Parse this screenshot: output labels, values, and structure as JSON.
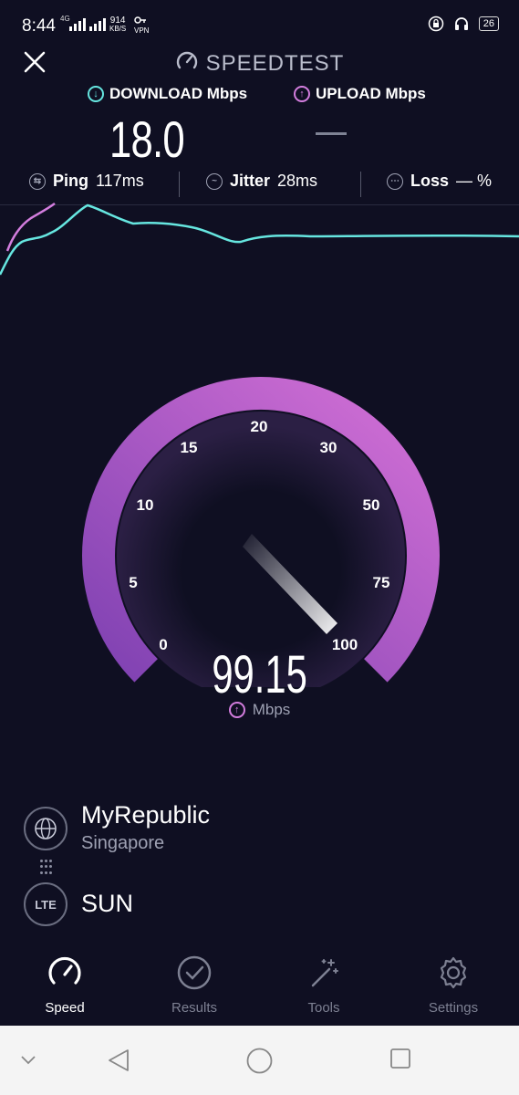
{
  "status_bar": {
    "time": "8:44",
    "network": "4G",
    "speed_value": "914",
    "speed_unit": "KB/S",
    "vpn": "VPN",
    "battery": "26"
  },
  "header": {
    "title": "SPEEDTEST",
    "close_icon": "close-icon"
  },
  "download": {
    "label": "DOWNLOAD Mbps",
    "value": "18.0",
    "color": "#66e6e0"
  },
  "upload": {
    "label": "UPLOAD Mbps",
    "value": "",
    "color": "#d37dde"
  },
  "stats": {
    "ping_label": "Ping",
    "ping_value": "117ms",
    "jitter_label": "Jitter",
    "jitter_value": "28ms",
    "loss_label": "Loss",
    "loss_value": "— %"
  },
  "gauge": {
    "ticks": [
      "0",
      "5",
      "10",
      "15",
      "20",
      "30",
      "50",
      "75",
      "100"
    ],
    "current_speed": "99.15",
    "unit": "Mbps",
    "needle_level": 0.99,
    "arc_color_start": "#7b3fb0",
    "arc_color_end": "#d873d8"
  },
  "provider": {
    "isp_name": "MyRepublic",
    "isp_location": "Singapore",
    "network_type": "LTE",
    "carrier": "SUN"
  },
  "bottom_nav": {
    "items": [
      {
        "label": "Speed",
        "icon": "gauge-icon",
        "active": true
      },
      {
        "label": "Results",
        "icon": "check-circle-icon",
        "active": false
      },
      {
        "label": "Tools",
        "icon": "magic-wand-icon",
        "active": false
      },
      {
        "label": "Settings",
        "icon": "gear-icon",
        "active": false
      }
    ]
  },
  "system_nav": {
    "icons": [
      "chevron-down-icon",
      "back-icon",
      "home-icon",
      "recents-icon"
    ]
  }
}
